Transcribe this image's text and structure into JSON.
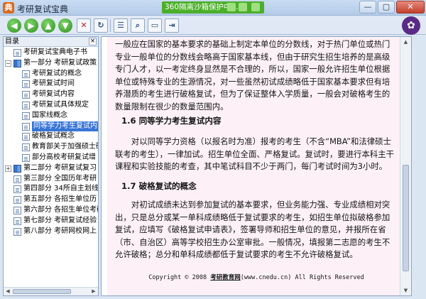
{
  "window": {
    "title": "考研复试宝典",
    "sandbox_text": "360隔离沙箱保护中...",
    "minimize": "—",
    "maximize": "▢",
    "close": "✕"
  },
  "toolbar": {
    "back_icon": "arrow-left-icon",
    "forward_icon": "arrow-right-icon",
    "up_icon": "arrow-up-icon",
    "down_icon": "arrow-down-icon",
    "stop_icon": "stop-icon",
    "refresh_icon": "refresh-icon",
    "contents_icon": "contents-pane-icon",
    "search_icon": "search-icon",
    "image_icon": "image-icon",
    "exit_icon": "exit-icon",
    "logo": "logo-icon"
  },
  "sidebar": {
    "header": "目录",
    "close": "×",
    "items": [
      {
        "label": "考研复试宝典电子书"
      },
      {
        "label": "第一部分  考研复试政策",
        "pm": "−"
      },
      {
        "label": "考研复试的概念"
      },
      {
        "label": "考研复试时间"
      },
      {
        "label": "考研复试内容"
      },
      {
        "label": "考研复试具体规定"
      },
      {
        "label": "国家线概念"
      },
      {
        "label": "同等学力考生复试内容"
      },
      {
        "label": "破格复试概念"
      },
      {
        "label": "教育部关于加强硕士研究生"
      },
      {
        "label": "部分高校考研复试增"
      },
      {
        "label": "第二部分  考研复试复习",
        "pm": "+"
      },
      {
        "label": "第三部分  全国历年考研"
      },
      {
        "label": "第四部分  34所自主划线"
      },
      {
        "label": "第五部分  各招生单位历"
      },
      {
        "label": "第六部分  各招生单位考研"
      },
      {
        "label": "第七部分  考研复试经验"
      },
      {
        "label": "第八部分  考研网校网上"
      }
    ]
  },
  "content": {
    "para1": "一般应在国家的基本要求的基础上制定本单位的分数线，对于热门单位或热门专业一般单位的分数线会略高于国家基本线，但由于研究生招生培养的是高级专门人才，以一考定终身显然是不合理的，所以，国家一般允许招生单位根据单位或特殊专业的生源情况，对一些虽然初试成绩略低于国家基本要求但有培养潜质的考生进行破格复试，但为了保证整体入学质量，一般会对破格考生的数量限制在很少的数量范围内。",
    "heading1": "1.6 同等学力考生复试内容",
    "para2": "对以同等学力资格（以报名时为准）报考的考生（不含“MBA”和法律硕士联考的考生），一律加试。招生单位全面、严格复试。复试时，要进行本科主干课程和实验技能的考查，其中笔试科目不少于两门，每门考试时间为3小时。",
    "heading2": "1.7 破格复试的概念",
    "para3": "对初试成绩未达到参加复试的基本要求，但业务能力强、专业成绩相对突出，只是总分或某一单科成绩略低于复试要求的考生，如招生单位拟破格参加复试，应填写《破格复试申请表》，签署导师和招生单位的意见，并报所在省（市、自治区）高等学校招生办公室审批。一般情况，填报第二志愿的考生不允许破格；总分和单科成绩都低于复试要求的考生不允许破格复试。",
    "footer_prefix": "Copyright © 2008 ",
    "footer_brand": "考研教育网",
    "footer_suffix": "(www.cnedu.cn) All Rights Reserved"
  },
  "colors": {
    "page_bg": "#fdf1f7",
    "selection": "#3875d7",
    "sandbox": "#4caf2a"
  }
}
